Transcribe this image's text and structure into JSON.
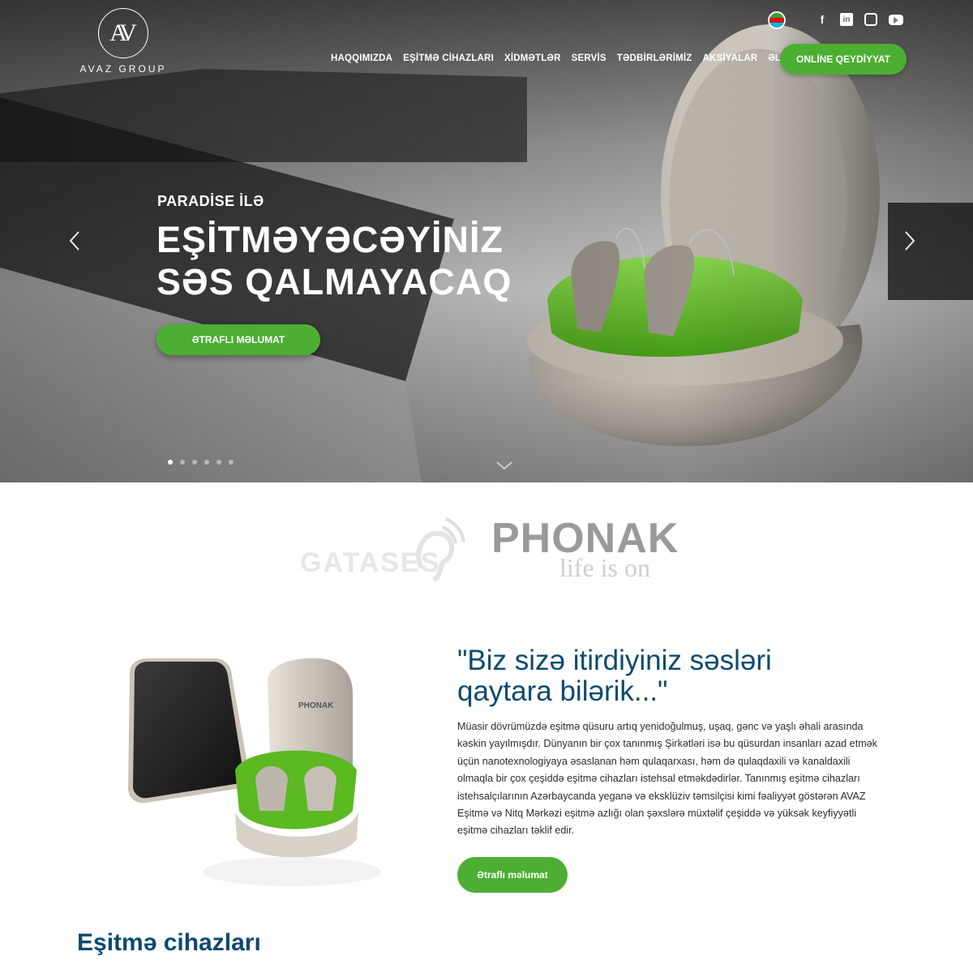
{
  "brand": {
    "logo_mark": "AV",
    "name": "AVAZ GROUP"
  },
  "header": {
    "language_flag": "az-flag",
    "social": [
      {
        "name": "facebook-icon",
        "glyph": "f"
      },
      {
        "name": "linkedin-icon",
        "glyph": "in"
      },
      {
        "name": "instagram-icon",
        "glyph": ""
      },
      {
        "name": "youtube-icon",
        "glyph": ""
      }
    ],
    "nav": [
      "HAQQIMIZDA",
      "EŞİTMƏ CİHAZLARI",
      "XİDMƏTLƏR",
      "SERVİS",
      "TƏDBİRLƏRİMİZ",
      "AKSİYALAR",
      "ƏLAQƏ"
    ],
    "cta": "ONLİNE QEYDİYYAT"
  },
  "hero": {
    "subtitle": "PARADİSE İLƏ",
    "title_line1": "EŞİTMƏYƏCƏYİNİZ",
    "title_line2": "SƏS QALMAYACAQ",
    "button": "ƏTRAFLI MƏLUMAT",
    "slides": 6,
    "active_slide": 1
  },
  "partners": {
    "left": "GATASES",
    "right": "PHONAK",
    "right_tagline": "life is on"
  },
  "about": {
    "quote_line1": "\"Biz sizə itirdiyiniz səsləri",
    "quote_line2": "qaytara bilərik...\"",
    "text": "Müasir dövrümüzdə eşitmə qüsuru artıq yenidoğulmuş, uşaq, gənc və yaşlı əhali arasında kəskin yayılmışdır. Dünyanın bir çox tanınmış Şirkətləri isə bu qüsurdan insanları azad etmək üçün nanotexnologiyaya əsaslanan həm qulaqarxası, həm də qulaqdaxili və kanaldaxili olmaqla bir çox çeşiddə eşitmə cihazları istehsal etməkdədirlər. Tanınmış eşitmə cihazları istehsalçılarının Azərbaycanda yeganə və eksklüziv təmsilçisi kimi fəaliyyət göstərən AVAZ Eşitmə və Nitq Mərkəzi eşitmə azlığı olan şəxslərə müxtəlif çeşiddə və yüksək keyfiyyətli eşitmə cihazları təklif edir.",
    "image_label": "PHONAK",
    "button": "Ətraflı məlumat"
  },
  "devices_section": {
    "title": "Eşitmə cihazları"
  },
  "colors": {
    "accent": "#4caf33",
    "heading": "#0b4a6f"
  }
}
